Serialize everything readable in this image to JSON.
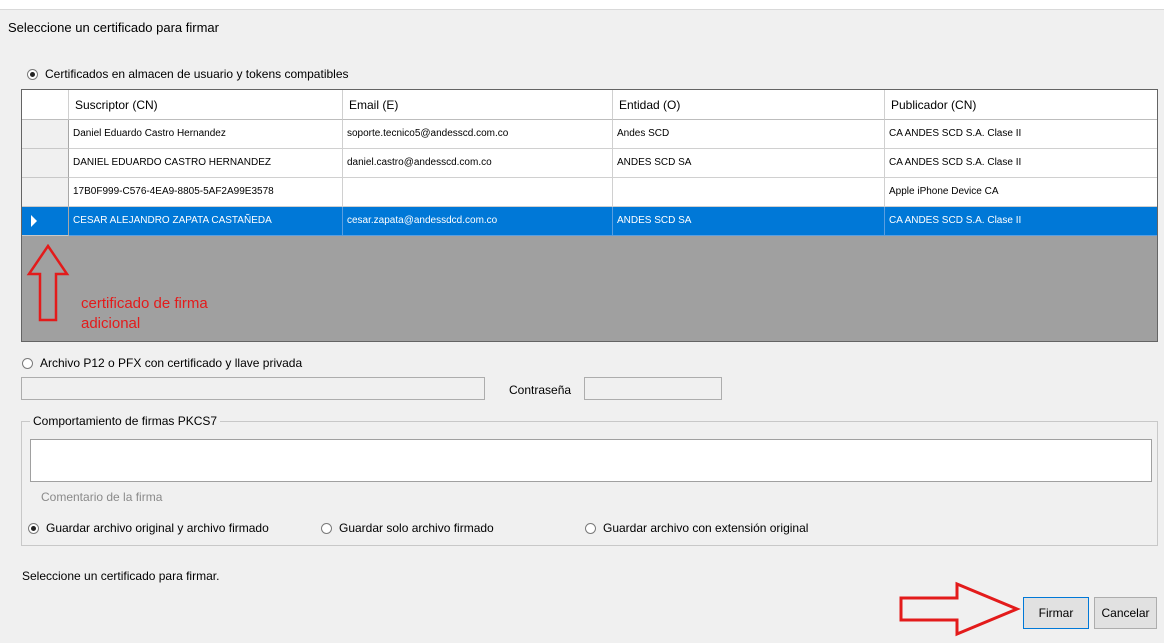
{
  "dialog": {
    "title": "Seleccione un certificado para firmar"
  },
  "store_option": {
    "label": "Certificados en almacen de usuario y tokens compatibles",
    "selected": true
  },
  "grid": {
    "columns": [
      "Suscriptor (CN)",
      "Email (E)",
      "Entidad (O)",
      "Publicador (CN)"
    ],
    "rows": [
      [
        "Daniel Eduardo Castro Hernandez",
        "soporte.tecnico5@andesscd.com.co",
        "Andes SCD",
        "CA ANDES SCD S.A. Clase II"
      ],
      [
        "DANIEL EDUARDO CASTRO HERNANDEZ",
        "daniel.castro@andesscd.com.co",
        "ANDES SCD SA",
        "CA ANDES SCD S.A. Clase II"
      ],
      [
        "17B0F999-C576-4EA9-8805-5AF2A99E3578",
        "",
        "",
        "Apple iPhone Device CA"
      ],
      [
        "CESAR ALEJANDRO ZAPATA CASTAÑEDA",
        "cesar.zapata@andessdcd.com.co",
        "ANDES SCD SA",
        "CA ANDES SCD S.A. Clase II"
      ]
    ],
    "selected_row": 3
  },
  "annotation": {
    "line1": "certificado de firma",
    "line2": "adicional",
    "color": "#e31b1b"
  },
  "file_option": {
    "label": "Archivo P12 o PFX con certificado y llave privada",
    "selected": false,
    "path_value": "",
    "password_label": "Contraseña",
    "password_value": ""
  },
  "pkcs7": {
    "group_label": "Comportamiento de firmas PKCS7",
    "comment_value": "",
    "comment_label": "Comentario de la firma",
    "options": [
      {
        "label": "Guardar archivo original y archivo firmado",
        "selected": true
      },
      {
        "label": "Guardar solo archivo firmado",
        "selected": false
      },
      {
        "label": "Guardar archivo con extensión original",
        "selected": false
      }
    ]
  },
  "status": "Seleccione un certificado para firmar.",
  "buttons": {
    "sign": "Firmar",
    "cancel": "Cancelar"
  },
  "colors": {
    "selection": "#0078d7",
    "annotation_red": "#e31b1b"
  },
  "icons": [
    "radio-selected",
    "radio-unselected",
    "row-selector-caret",
    "red-arrow-up",
    "red-arrow-right"
  ]
}
